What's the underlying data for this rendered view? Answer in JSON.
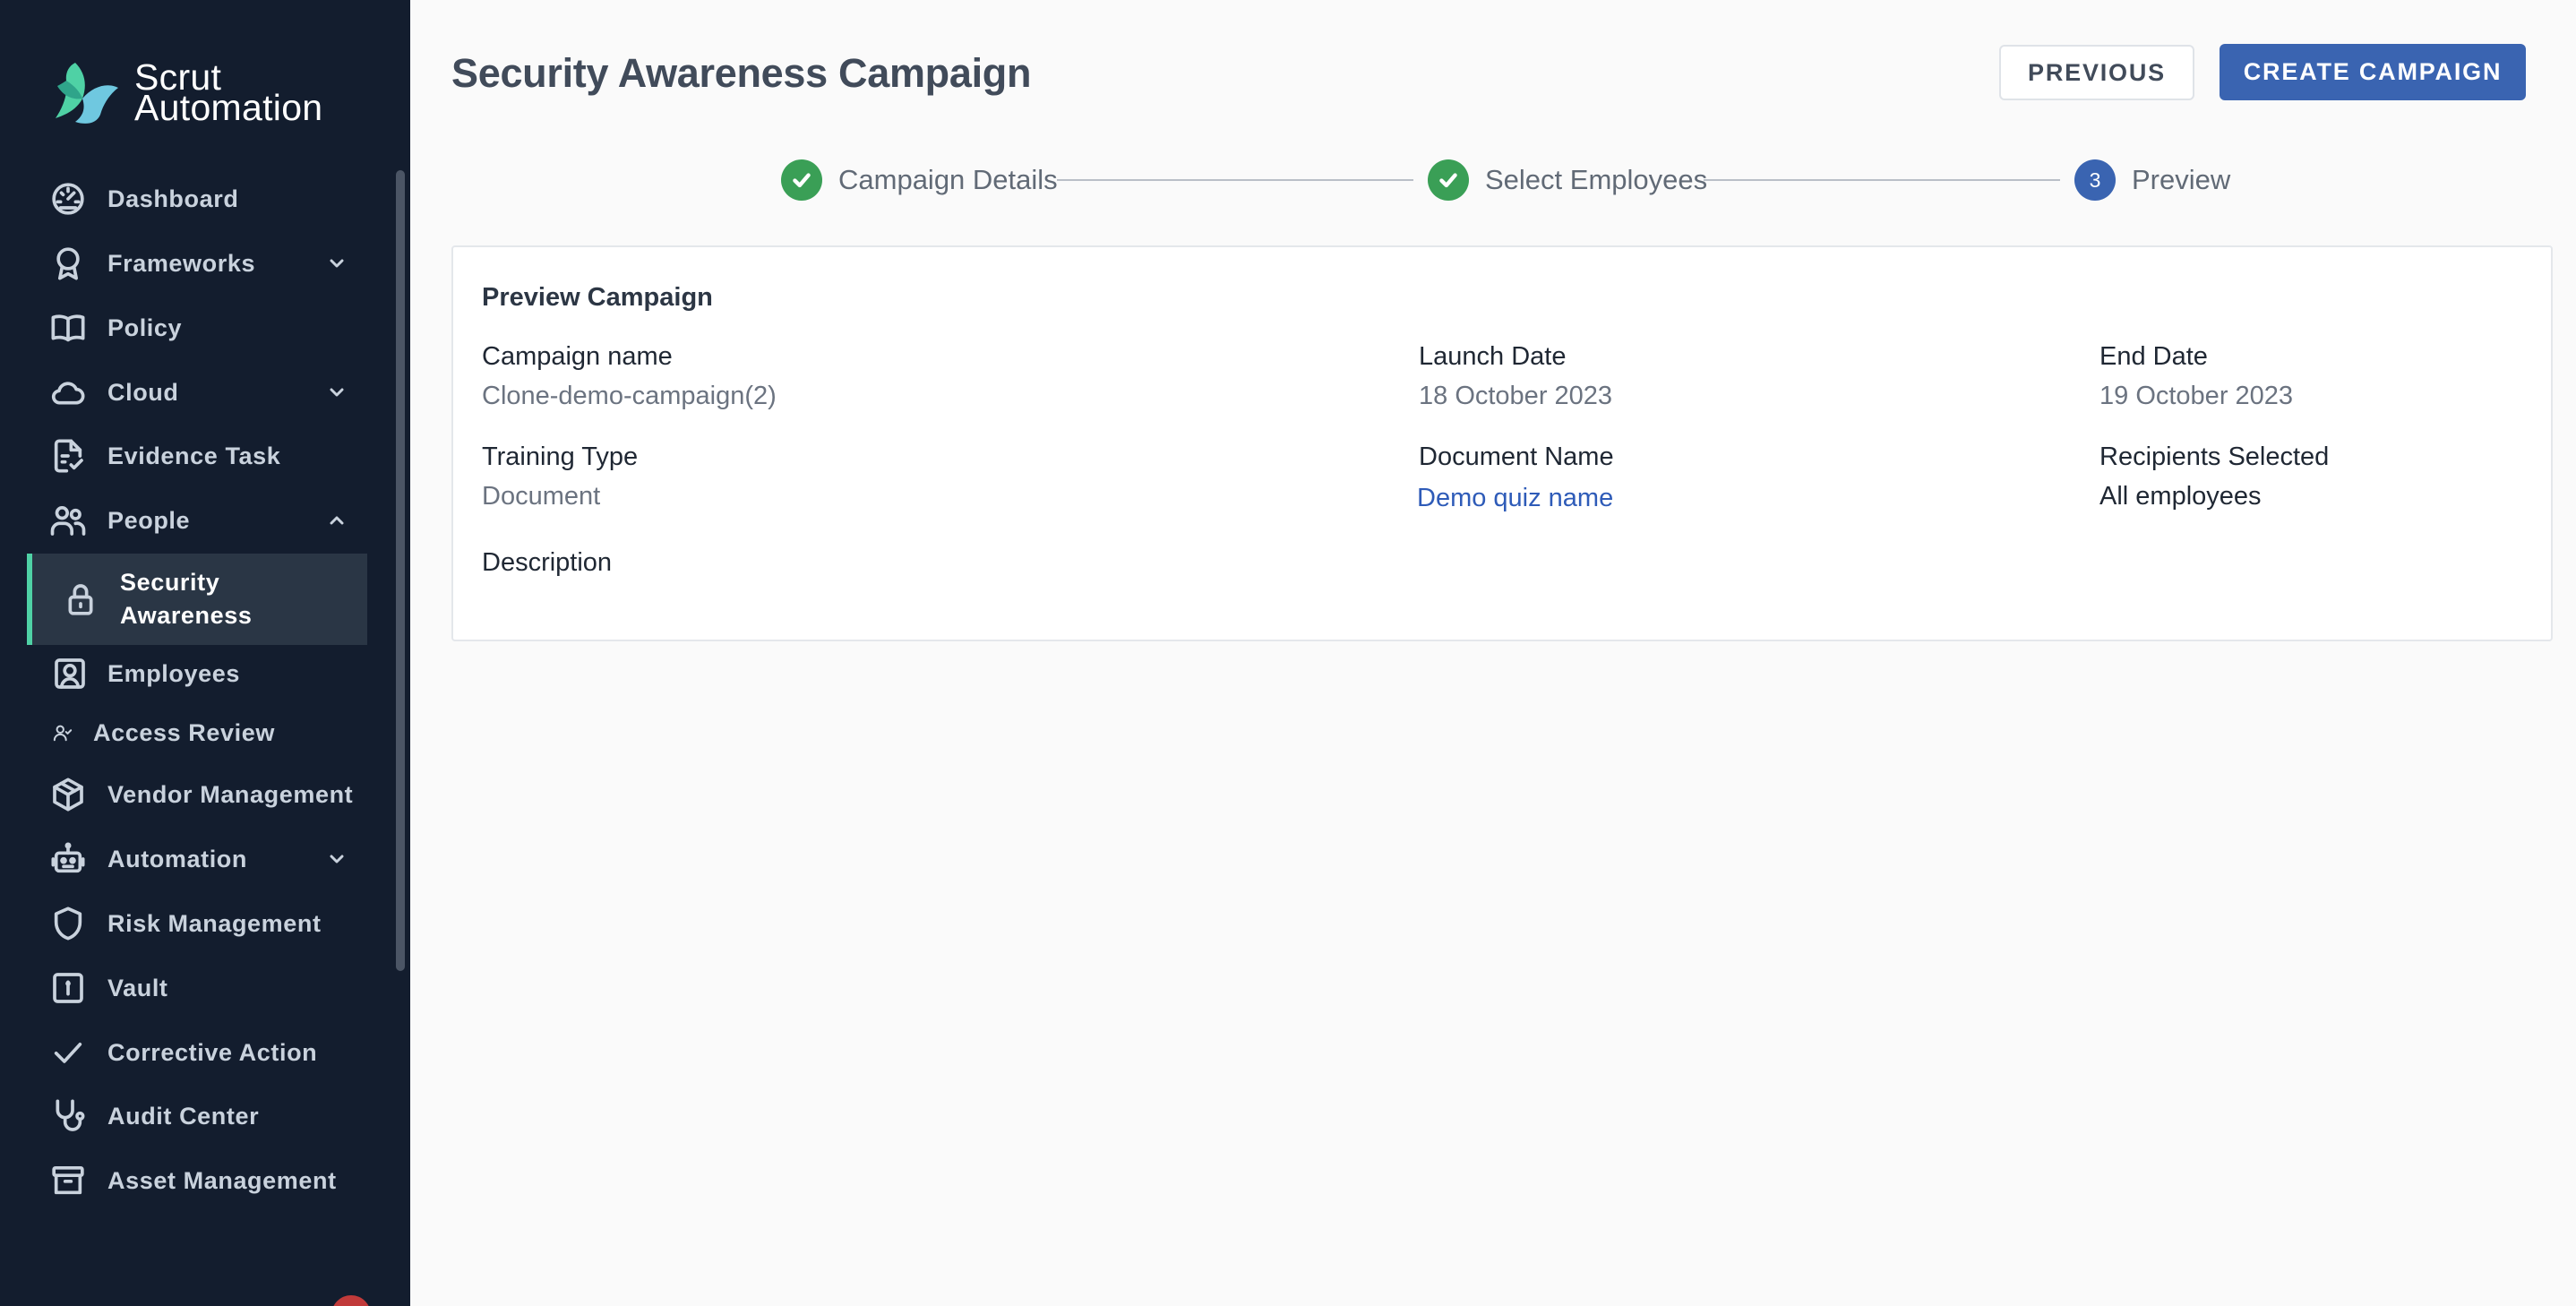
{
  "app": {
    "logo_line1": "Scrut",
    "logo_line2": "Automation"
  },
  "sidebar": {
    "items": [
      {
        "label": "Dashboard",
        "icon": "dashboard-icon"
      },
      {
        "label": "Frameworks",
        "icon": "award-icon",
        "chevron": "down"
      },
      {
        "label": "Policy",
        "icon": "book-icon"
      },
      {
        "label": "Cloud",
        "icon": "cloud-icon",
        "chevron": "down"
      },
      {
        "label": "Evidence Task",
        "icon": "file-check-icon"
      },
      {
        "label": "People",
        "icon": "people-icon",
        "chevron": "up"
      },
      {
        "label": "Security Awareness",
        "icon": "lock-icon",
        "active": true
      },
      {
        "label": "Employees",
        "icon": "user-square-icon"
      },
      {
        "label": "Access Review",
        "icon": "user-check-icon"
      },
      {
        "label": "Vendor Management",
        "icon": "box-icon"
      },
      {
        "label": "Automation",
        "icon": "robot-icon",
        "chevron": "down"
      },
      {
        "label": "Risk Management",
        "icon": "shield-icon"
      },
      {
        "label": "Vault",
        "icon": "vault-icon"
      },
      {
        "label": "Corrective Action",
        "icon": "check-icon"
      },
      {
        "label": "Audit Center",
        "icon": "stethoscope-icon"
      },
      {
        "label": "Asset Management",
        "icon": "archive-icon"
      }
    ]
  },
  "header": {
    "title": "Security Awareness Campaign",
    "previous_label": "PREVIOUS",
    "create_label": "CREATE CAMPAIGN"
  },
  "stepper": {
    "steps": [
      {
        "label": "Campaign Details",
        "status": "done"
      },
      {
        "label": "Select Employees",
        "status": "done"
      },
      {
        "label": "Preview",
        "status": "current",
        "number": "3"
      }
    ]
  },
  "preview": {
    "title": "Preview Campaign",
    "campaign_name_label": "Campaign name",
    "campaign_name": "Clone-demo-campaign(2)",
    "launch_date_label": "Launch Date",
    "launch_date": "18 October 2023",
    "end_date_label": "End Date",
    "end_date": "19 October 2023",
    "training_type_label": "Training Type",
    "training_type": "Document",
    "document_name_label": "Document Name",
    "document_name": "Demo quiz name",
    "recipients_label": "Recipients Selected",
    "recipients": "All employees",
    "description_label": "Description"
  },
  "colors": {
    "sidebar_bg": "#131d2e",
    "active_accent": "#4fd1a5",
    "primary": "#3a64b1",
    "success": "#3a9f56",
    "link": "#2e5bb8"
  }
}
